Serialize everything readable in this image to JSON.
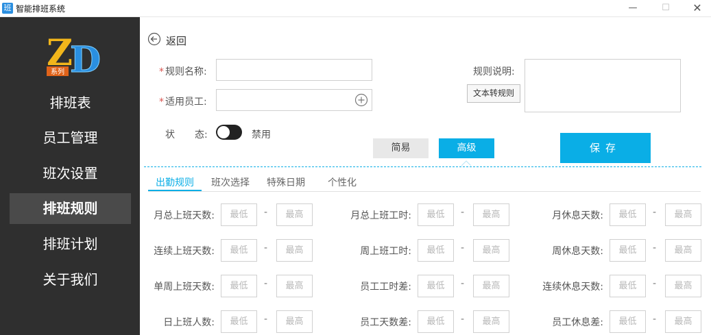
{
  "window": {
    "icon_text": "班",
    "title": "智能排班系统",
    "min": "—",
    "max": "☐",
    "close": "✕"
  },
  "sidebar": {
    "logo_main": "ZD",
    "logo_sub": "系列",
    "items": [
      {
        "label": "排班表"
      },
      {
        "label": "员工管理"
      },
      {
        "label": "班次设置"
      },
      {
        "label": "排班规则"
      },
      {
        "label": "排班计划"
      },
      {
        "label": "关于我们"
      }
    ],
    "active_index": 3
  },
  "header": {
    "back_label": "返回"
  },
  "form": {
    "required_mark": "*",
    "rule_name_label": "规则名称:",
    "rule_name_value": "",
    "employees_label": "适用员工:",
    "employees_value": "",
    "status_label_a": "状",
    "status_label_b": "态:",
    "status_text": "禁用",
    "status_on": false,
    "description_label": "规则说明:",
    "description_value": "",
    "text_to_rule_button": "文本转规则"
  },
  "mode": {
    "simple": "简易",
    "advanced": "高级",
    "selected": "advanced"
  },
  "save_button": "保存",
  "tabs": [
    {
      "label": "出勤规则"
    },
    {
      "label": "班次选择"
    },
    {
      "label": "特殊日期"
    },
    {
      "label": "个性化"
    }
  ],
  "active_tab": 0,
  "range_placeholders": {
    "min": "最低",
    "max": "最高",
    "separator": "-"
  },
  "rules": [
    [
      "月总上班天数:",
      "月总上班工时:",
      "月休息天数:"
    ],
    [
      "连续上班天数:",
      "周上班工时:",
      "周休息天数:"
    ],
    [
      "单周上班天数:",
      "员工工时差:",
      "连续休息天数:"
    ],
    [
      "日上班人数:",
      "员工天数差:",
      "员工休息差:"
    ]
  ],
  "colors": {
    "accent": "#0aaee6",
    "sidebar_bg": "#2f2f2f",
    "sidebar_active": "#4a4a4a",
    "required": "#d9534f"
  }
}
